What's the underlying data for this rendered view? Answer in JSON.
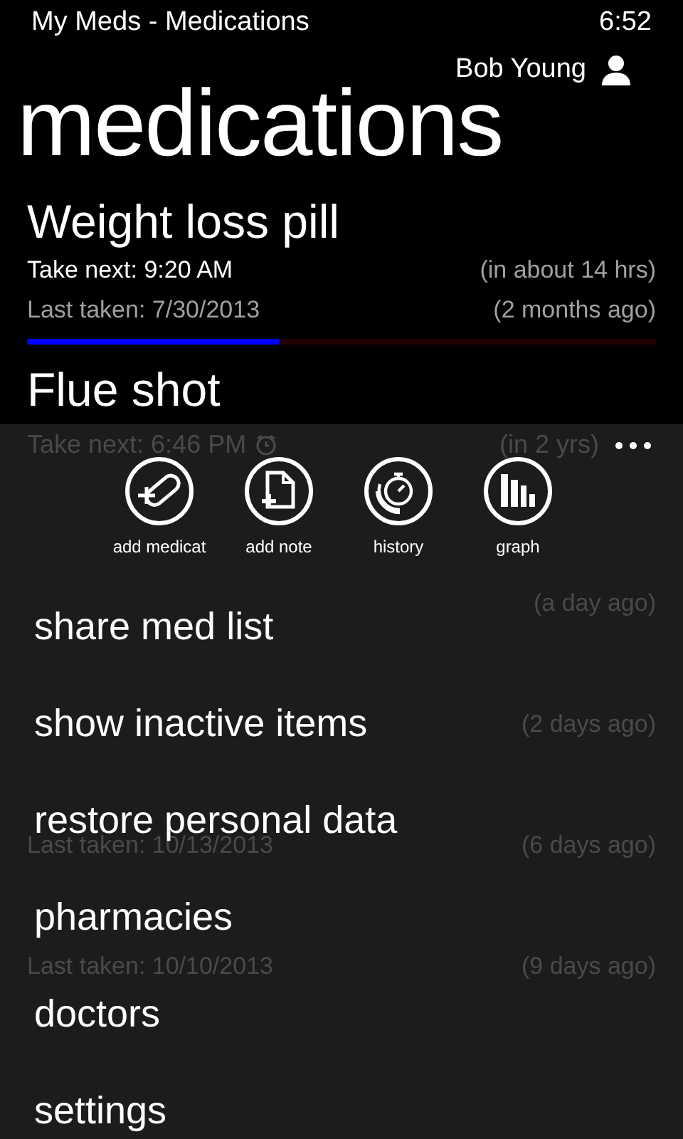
{
  "status_bar": {
    "app_title": "My Meds - Medications",
    "time": "6:52"
  },
  "user": {
    "name": "Bob Young"
  },
  "page_title": "medications",
  "medications": [
    {
      "name": "Weight loss pill",
      "take_next": "Take next: 9:20 AM",
      "take_next_in": "(in about 14 hrs)",
      "last_taken": "Last taken: 7/30/2013",
      "last_taken_ago": "(2 months ago)",
      "level": 0.4
    },
    {
      "name": "Flue shot"
    }
  ],
  "dimmed_list": {
    "take_next": "Take next: 6:46 PM",
    "reminder": true,
    "take_next_in": "(in 2 yrs)",
    "items": [
      {
        "last_taken_ago": "(a day ago)"
      },
      {
        "last_taken_ago": "(2 days ago)"
      },
      {
        "last_taken": "Last taken: 10/13/2013",
        "last_taken_ago": "(6 days ago)"
      },
      {
        "last_taken": "Last taken: 10/10/2013",
        "last_taken_ago": "(9 days ago)"
      }
    ]
  },
  "app_bar": {
    "buttons": [
      {
        "kind": "pill",
        "label": "add medicat"
      },
      {
        "kind": "note",
        "label": "add note"
      },
      {
        "kind": "history",
        "label": "history"
      },
      {
        "kind": "graph",
        "label": "graph"
      }
    ],
    "menu_items": [
      "share med list",
      "show inactive items",
      "restore personal data",
      "pharmacies",
      "doctors",
      "settings"
    ]
  }
}
